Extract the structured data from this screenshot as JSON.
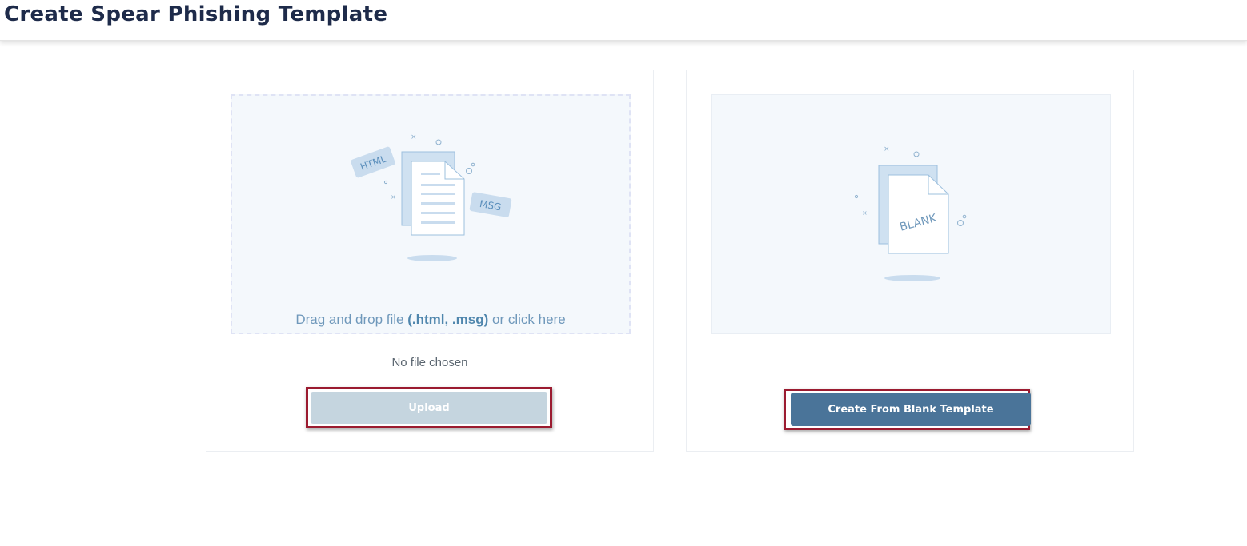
{
  "page": {
    "title": "Create Spear Phishing Template"
  },
  "upload_card": {
    "illustration_badges": {
      "html": "HTML",
      "msg": "MSG"
    },
    "drop_text_prefix": "Drag and drop file ",
    "drop_text_formats": "(.html, .msg)",
    "drop_text_suffix": " or click here",
    "file_status": "No file chosen",
    "upload_button": "Upload"
  },
  "blank_card": {
    "illustration_label": "BLANK",
    "create_button": "Create From Blank Template"
  },
  "colors": {
    "title": "#1e2b4a",
    "accent_blue": "#4a7499",
    "disabled_button": "#c5d5df",
    "highlight_border": "#9b1b30",
    "panel_bg": "#f4f8fc"
  }
}
